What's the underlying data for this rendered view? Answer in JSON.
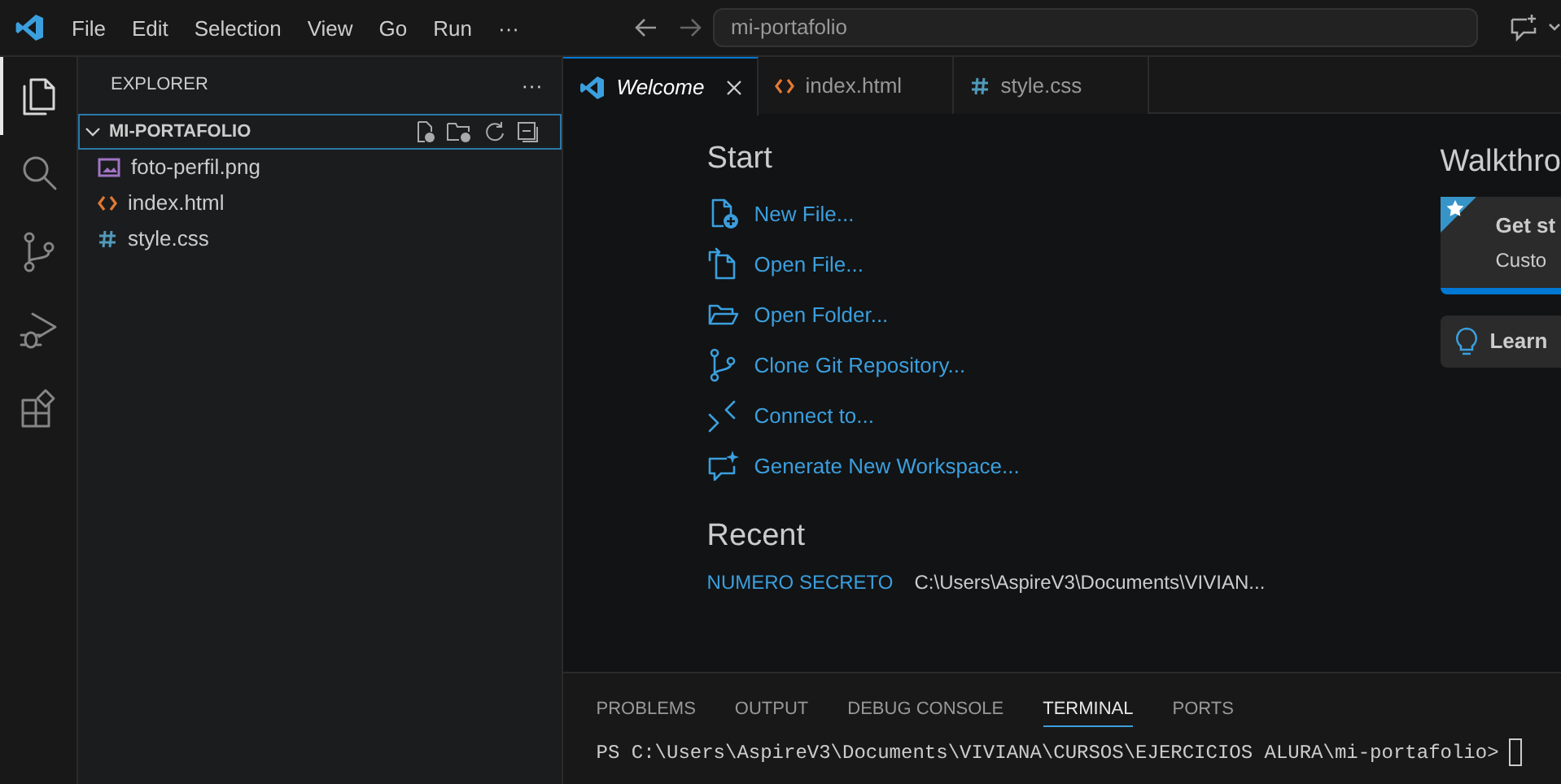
{
  "menu": [
    "File",
    "Edit",
    "Selection",
    "View",
    "Go",
    "Run",
    "···"
  ],
  "command_center": {
    "text": "mi-portafolio"
  },
  "activity_bar": [
    {
      "kind": "explorer",
      "selected": true
    },
    {
      "kind": "search",
      "selected": false
    },
    {
      "kind": "source-control",
      "selected": false
    },
    {
      "kind": "run-debug",
      "selected": false
    },
    {
      "kind": "extensions",
      "selected": false
    }
  ],
  "sidebar": {
    "title": "EXPLORER",
    "more": "···",
    "folder": {
      "name": "MI-PORTAFOLIO",
      "expanded": true,
      "children": [
        {
          "name": "foto-perfil.png",
          "kind": "image"
        },
        {
          "name": "index.html",
          "kind": "html"
        },
        {
          "name": "style.css",
          "kind": "css"
        }
      ]
    }
  },
  "tabs": [
    {
      "label": "Welcome",
      "kind": "welcome",
      "selected": true
    },
    {
      "label": "index.html",
      "kind": "html",
      "selected": false
    },
    {
      "label": "style.css",
      "kind": "css",
      "selected": false
    }
  ],
  "welcome": {
    "start_title": "Start",
    "start": [
      {
        "label": "New File...",
        "kind": "new-file"
      },
      {
        "label": "Open File...",
        "kind": "open-file"
      },
      {
        "label": "Open Folder...",
        "kind": "open-folder"
      },
      {
        "label": "Clone Git Repository...",
        "kind": "git"
      },
      {
        "label": "Connect to...",
        "kind": "remote"
      },
      {
        "label": "Generate New Workspace...",
        "kind": "generate"
      }
    ],
    "recent_title": "Recent",
    "recent": [
      {
        "name": "NUMERO SECRETO",
        "path": "C:\\Users\\AspireV3\\Documents\\VIVIAN..."
      }
    ],
    "walkthroughs_title": "Walkthro",
    "walkthroughs": [
      {
        "kind": "featured",
        "title": "Get st",
        "subtitle": "Custo"
      },
      {
        "kind": "tip",
        "title": "Learn"
      }
    ]
  },
  "panel": {
    "tabs": [
      {
        "label": "PROBLEMS",
        "selected": false
      },
      {
        "label": "OUTPUT",
        "selected": false
      },
      {
        "label": "DEBUG CONSOLE",
        "selected": false
      },
      {
        "label": "TERMINAL",
        "selected": true
      },
      {
        "label": "PORTS",
        "selected": false
      }
    ],
    "terminal_line": "PS C:\\Users\\AspireV3\\Documents\\VIVIANA\\CURSOS\\EJERCICIOS ALURA\\mi-portafolio>"
  }
}
